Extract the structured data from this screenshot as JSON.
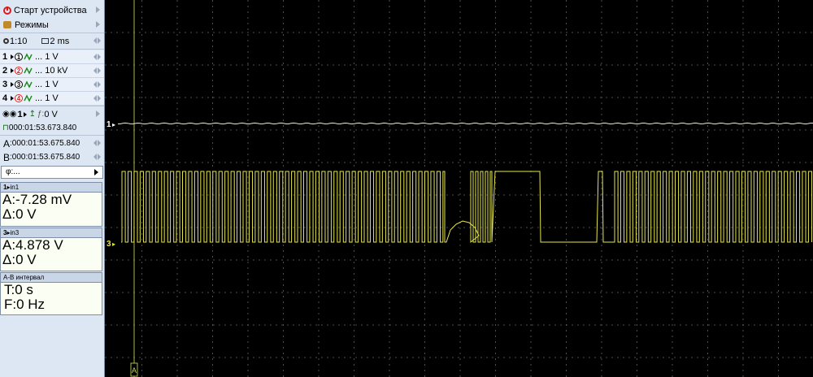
{
  "panel": {
    "start_label": "Старт устройства",
    "modes_label": "Режимы",
    "zoom": "1:10",
    "timebase": "2 ms",
    "channels": [
      {
        "num": "1",
        "badge": "1",
        "off": false,
        "value": "... 1 V"
      },
      {
        "num": "2",
        "badge": "2",
        "off": true,
        "value": "... 10 kV"
      },
      {
        "num": "3",
        "badge": "3",
        "off": false,
        "value": "... 1 V"
      },
      {
        "num": "4",
        "badge": "4",
        "off": true,
        "value": "... 1 V"
      }
    ],
    "trigger_channel": "1",
    "trigger_level": "0 V",
    "trigger_time": "000:01:53.673.840",
    "cursor_a_label": "A",
    "cursor_a": "000:01:53.675.840",
    "cursor_b_label": "B",
    "cursor_b": "000:01:53.675.840",
    "phi_label": "φ:..."
  },
  "measurements": [
    {
      "header": "in1",
      "ch": "1",
      "a": "A:-7.28 mV",
      "d": "Δ:0 V"
    },
    {
      "header": "in3",
      "ch": "3",
      "a": "A:4.878 V",
      "d": "Δ:0 V"
    }
  ],
  "interval": {
    "header": "A-B интервал",
    "t": "T:0 s",
    "f": "F:0 Hz"
  },
  "scope": {
    "ch1_marker": "1",
    "ch3_marker": "3",
    "cursor_label": "A",
    "colors": {
      "background": "#000000",
      "grid": "#4a4a4a",
      "ch1": "#e8e8d8",
      "ch3": "#e6e64a",
      "cursor": "#b8c84a"
    }
  }
}
